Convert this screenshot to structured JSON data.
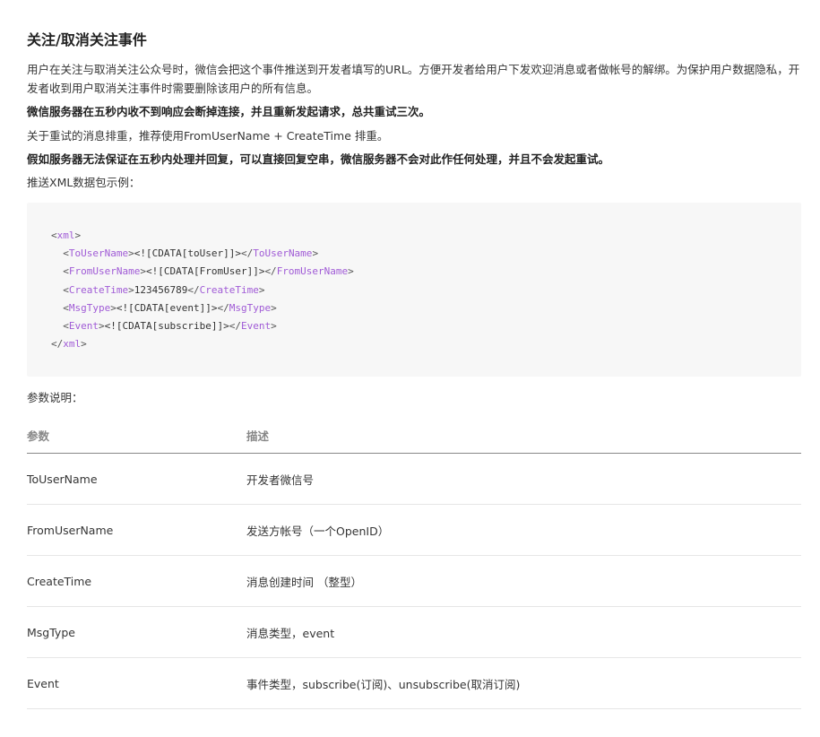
{
  "title": "关注/取消关注事件",
  "paragraphs": {
    "intro": "用户在关注与取消关注公众号时，微信会把这个事件推送到开发者填写的URL。方便开发者给用户下发欢迎消息或者做帐号的解绑。为保护用户数据隐私，开发者收到用户取消关注事件时需要删除该用户的所有信息。",
    "retry_warning": "微信服务器在五秒内收不到响应会断掉连接，并且重新发起请求，总共重试三次。",
    "dedup": "关于重试的消息排重，推荐使用FromUserName + CreateTime 排重。",
    "empty_reply": "假如服务器无法保证在五秒内处理并回复，可以直接回复空串，微信服务器不会对此作任何处理，并且不会发起重试。",
    "xml_example_label": "推送XML数据包示例："
  },
  "code": {
    "root_tag": "xml",
    "lines": [
      {
        "tag": "ToUserName",
        "value": "<![CDATA[toUser]]>"
      },
      {
        "tag": "FromUserName",
        "value": "<![CDATA[FromUser]]>"
      },
      {
        "tag": "CreateTime",
        "value": "123456789"
      },
      {
        "tag": "MsgType",
        "value": "<![CDATA[event]]>"
      },
      {
        "tag": "Event",
        "value": "<![CDATA[subscribe]]>"
      }
    ]
  },
  "params_label": "参数说明：",
  "table": {
    "headers": [
      "参数",
      "描述"
    ],
    "rows": [
      {
        "name": "ToUserName",
        "desc": "开发者微信号"
      },
      {
        "name": "FromUserName",
        "desc": "发送方帐号（一个OpenID）"
      },
      {
        "name": "CreateTime",
        "desc": "消息创建时间 （整型）"
      },
      {
        "name": "MsgType",
        "desc": "消息类型，event"
      },
      {
        "name": "Event",
        "desc": "事件类型，subscribe(订阅)、unsubscribe(取消订阅)"
      }
    ]
  },
  "colors": {
    "tag": "#a05bd6",
    "code_bg": "#f7f7f7",
    "header_text": "#888888"
  }
}
